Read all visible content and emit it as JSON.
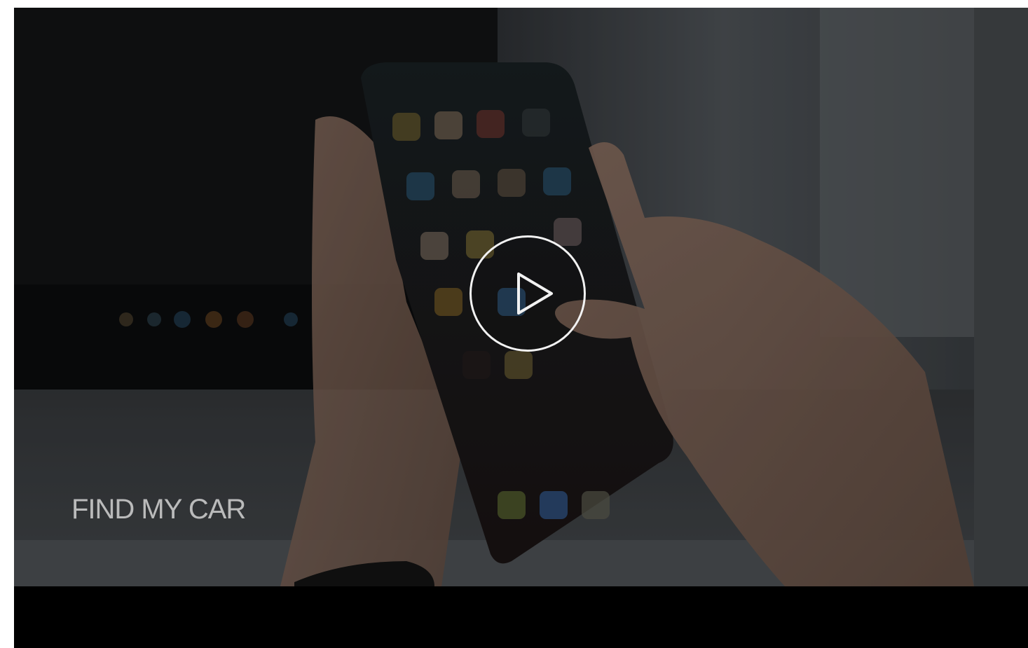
{
  "video": {
    "caption": "FIND MY CAR",
    "play_icon": "play-icon"
  },
  "colors": {
    "overlay_text": "#d9d9d9",
    "play_ring": "#f2f2f2",
    "bar": "#000000"
  }
}
